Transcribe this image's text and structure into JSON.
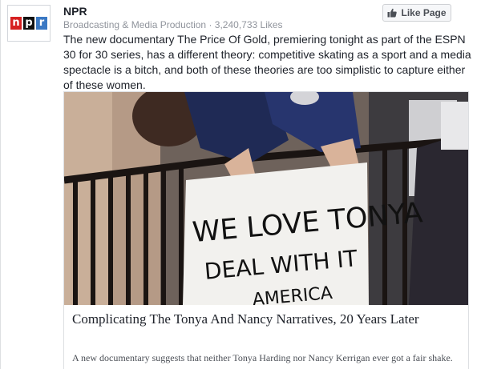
{
  "post": {
    "page_name": "NPR",
    "category": "Broadcasting & Media Production",
    "separator": "·",
    "likes": "3,240,733 Likes",
    "like_button": "Like Page",
    "text": "The new documentary The Price Of Gold, premiering tonight as part of the ESPN 30 for 30 series, has a different theory: competitive skating as a sport and a media spectacle is a bitch, and both of these theories are too simplistic to capture either of these women."
  },
  "logo": {
    "letters": [
      "n",
      "p",
      "r"
    ],
    "colors": [
      "#d62021",
      "#111111",
      "#3a78c3"
    ]
  },
  "link": {
    "image_sign_line1": "WE LOVE TONYA",
    "image_sign_line2": "DEAL WITH IT",
    "image_sign_line3": "AMERICA",
    "title": "Complicating The Tonya And Nancy Narratives, 20 Years Later",
    "description": "A new documentary suggests that neither Tonya Harding nor Nancy Kerrigan ever got a fair shake."
  },
  "icons": {
    "like_button_icon": "thumbs-up-icon"
  }
}
